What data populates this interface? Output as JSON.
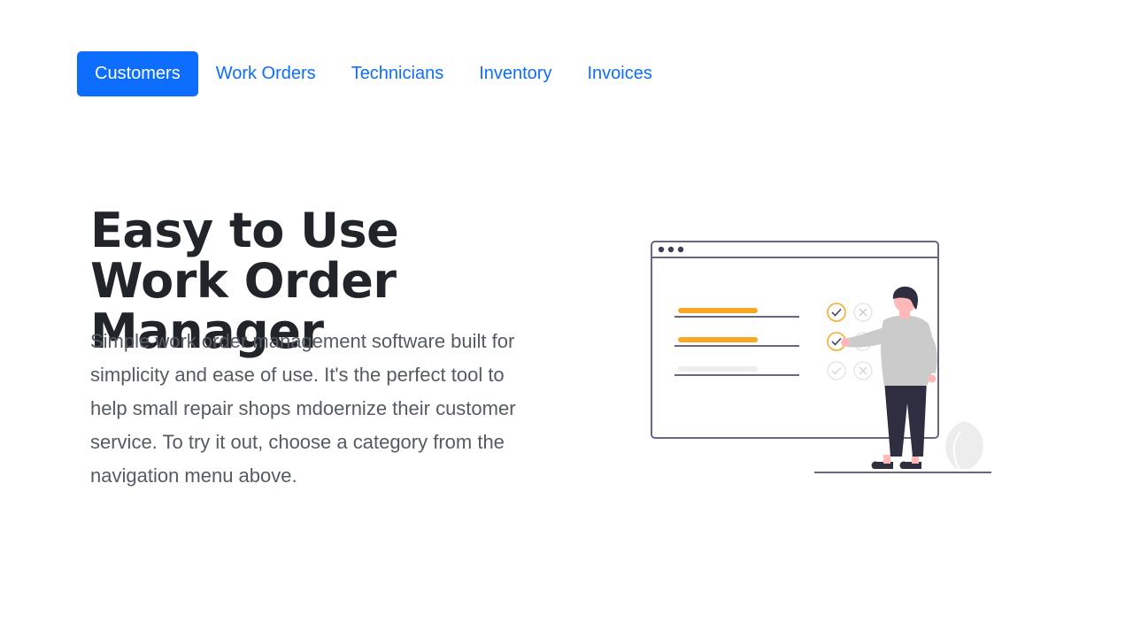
{
  "nav": {
    "items": [
      {
        "label": "Customers",
        "active": true
      },
      {
        "label": "Work Orders",
        "active": false
      },
      {
        "label": "Technicians",
        "active": false
      },
      {
        "label": "Inventory",
        "active": false
      },
      {
        "label": "Invoices",
        "active": false
      }
    ]
  },
  "hero": {
    "title": "Easy to Use Work Order Manager",
    "description": "Simple work order management software built for simplicity and ease of use. It's the perfect tool to help small repair shops mdoernize their customer service. To try it out, choose a category from the navigation menu above."
  },
  "colors": {
    "primary": "#0d6efd",
    "heading": "#212529",
    "body_text": "#555b62",
    "accent_orange": "#f9a826",
    "outline": "#6b6680"
  },
  "illustration": {
    "icon": "person-checking-list-illustration"
  }
}
